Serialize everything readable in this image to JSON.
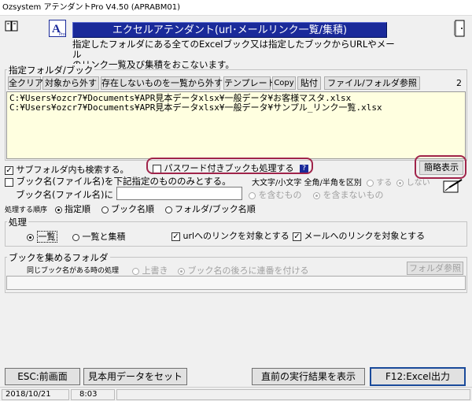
{
  "window": {
    "title": "Ozsystem アテンダントPro V4.50 (APRABM01)"
  },
  "header": {
    "title": "エクセルアテンダント(url･メールリンク一覧/集積)",
    "description_line1": "指定したフォルダにある全てのExcelブック又は指定したブックからURLやメール",
    "description_line2": "のリンク一覧及び集積をおこないます。"
  },
  "folder_group": {
    "label": "指定フォルダ/ブック",
    "buttons": {
      "clear_all": "全クリア",
      "exclude": "対象から外す",
      "exclude_missing": "存在しないものを一覧から外す",
      "template": "テンプレート",
      "copy": "Copy",
      "paste": "貼付",
      "browse": "ファイル/フォルダ参照"
    },
    "count": "2",
    "paths": [
      "C:¥Users¥ozcr7¥Documents¥APR見本データxlsx¥一般データ¥お客様マスタ.xlsx",
      "C:¥Users¥ozcr7¥Documents¥APR見本データxlsx¥一般データ¥サンプル_リンク一覧.xlsx"
    ]
  },
  "options": {
    "subfolder": "サブフォルダ内も検索する。",
    "password": "パスワード付きブックも処理する",
    "simple_view": "簡略表示",
    "book_filter": "ブック名(ファイル名)を下記指定のものの",
    "book_filter_tail": "みとする。",
    "case_label": "大文字/小文字 全角/半角を区別",
    "case_yes": "する",
    "case_no": "しない",
    "book_name_label": "ブック名(ファイル名)に",
    "contains": "を含むもの",
    "not_contains": "を含まないもの",
    "order_label": "処理する順序",
    "order_specified": "指定順",
    "order_book": "ブック名順",
    "order_folder": "フォルダ/ブック名順"
  },
  "process": {
    "label": "処理",
    "list": "一覧",
    "list_collect": "一覧と集積",
    "url_links": "urlへのリンクを対象とする",
    "mail_links": "メールへのリンクを対象とする"
  },
  "collect": {
    "label": "ブックを集めるフォルダ",
    "same_name_label": "同じブック名がある時の処理",
    "overwrite": "上書き",
    "suffix": "ブック名の後ろに連番を付ける",
    "browse": "フォルダ参照"
  },
  "footer": {
    "esc": "ESC:前画面",
    "sample": "見本用データをセット",
    "last_result": "直前の実行結果を表示",
    "f12": "F12:Excel出力"
  },
  "status": {
    "date": "2018/10/21",
    "time": "8:03"
  }
}
